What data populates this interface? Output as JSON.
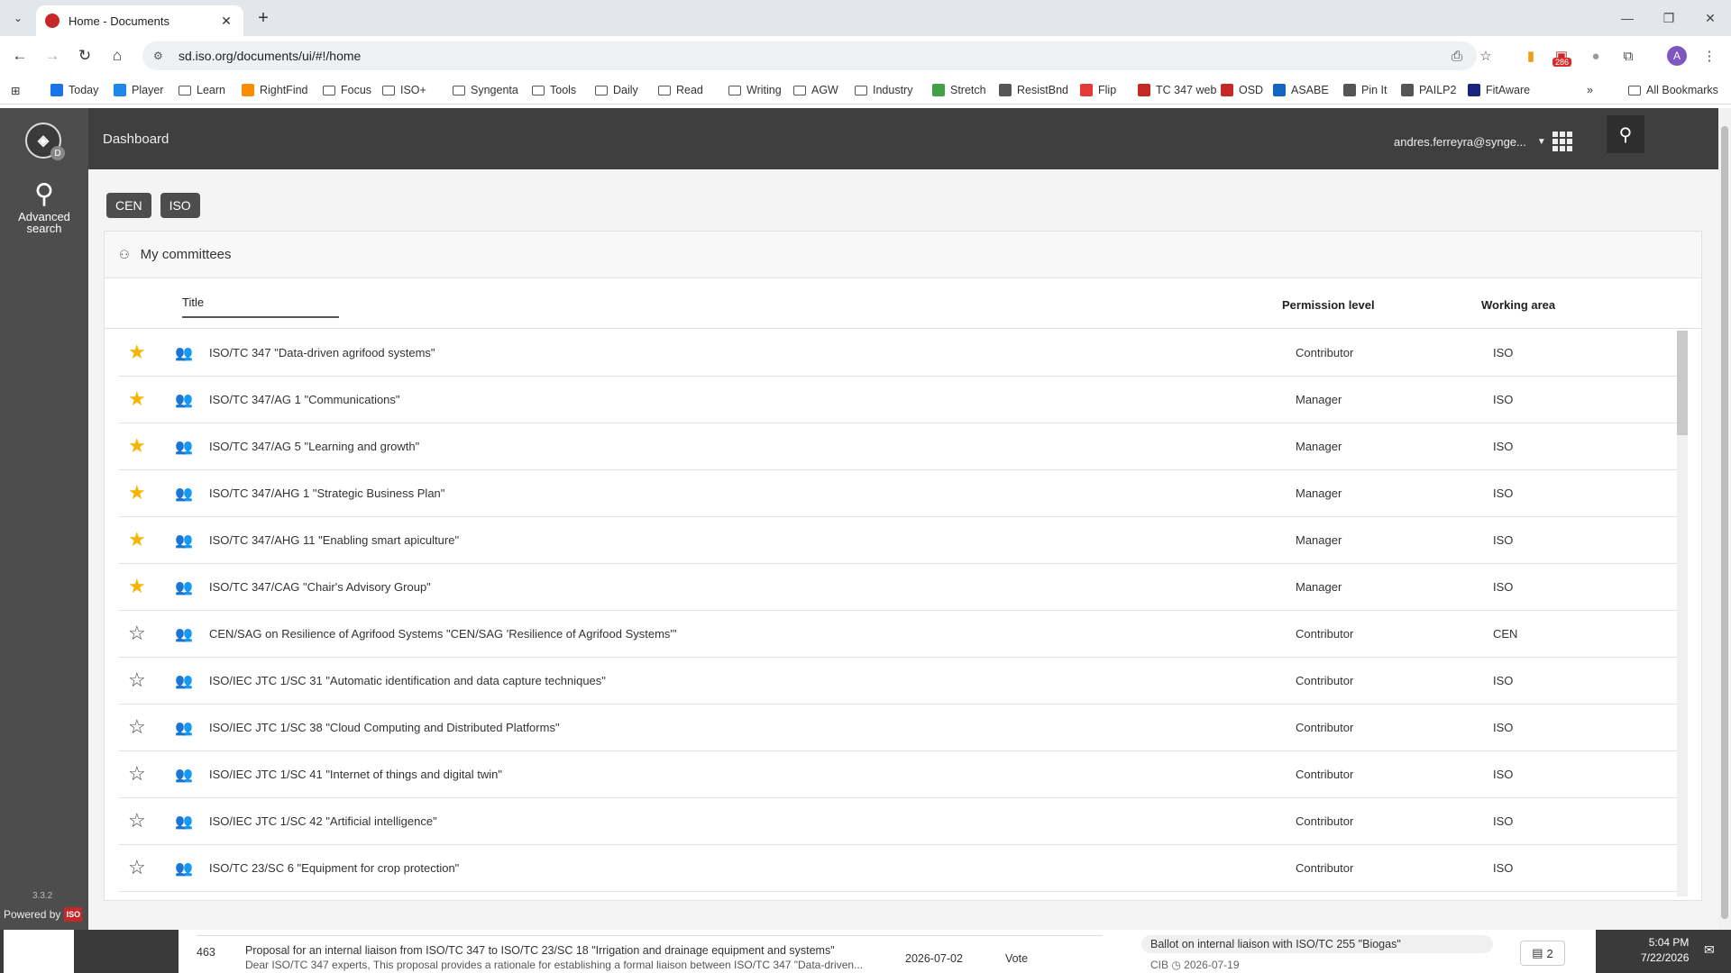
{
  "browser": {
    "tab_title": "Home - Documents",
    "url": "sd.iso.org/documents/ui/#!/home",
    "extension_badge": "286",
    "profile_initial": "A",
    "bookmarks": [
      {
        "label": "Today",
        "kind": "icon",
        "color": "#1a73e8"
      },
      {
        "label": "Player",
        "kind": "icon",
        "color": "#1e88e5"
      },
      {
        "label": "Learn",
        "kind": "folder"
      },
      {
        "label": "RightFind",
        "kind": "icon",
        "color": "#fb8c00"
      },
      {
        "label": "Focus",
        "kind": "folder"
      },
      {
        "label": "ISO+",
        "kind": "folder"
      },
      {
        "label": "Syngenta",
        "kind": "folder"
      },
      {
        "label": "Tools",
        "kind": "folder"
      },
      {
        "label": "Daily",
        "kind": "folder"
      },
      {
        "label": "Read",
        "kind": "folder"
      },
      {
        "label": "Writing",
        "kind": "folder"
      },
      {
        "label": "AGW",
        "kind": "folder"
      },
      {
        "label": "Industry",
        "kind": "folder"
      },
      {
        "label": "Stretch",
        "kind": "icon",
        "color": "#43a047"
      },
      {
        "label": "ResistBnd",
        "kind": "icon",
        "color": "#555555"
      },
      {
        "label": "Flip",
        "kind": "icon",
        "color": "#e53935"
      },
      {
        "label": "TC 347 web",
        "kind": "icon",
        "color": "#c62828"
      },
      {
        "label": "OSD",
        "kind": "icon",
        "color": "#c62828"
      },
      {
        "label": "ASABE",
        "kind": "icon",
        "color": "#1565c0"
      },
      {
        "label": "Pin It",
        "kind": "icon",
        "color": "#555555"
      },
      {
        "label": "PAILP2",
        "kind": "icon",
        "color": "#555555"
      },
      {
        "label": "FitAware",
        "kind": "icon",
        "color": "#1a237e"
      }
    ],
    "all_bookmarks": "All Bookmarks"
  },
  "sidebar": {
    "advanced_search": "Advanced search",
    "logo_badge": "D",
    "version": "3.3.2",
    "powered_by": "Powered by",
    "powered_logo": "ISO"
  },
  "topbar": {
    "title": "Dashboard",
    "user": "andres.ferreyra@synge..."
  },
  "filters": [
    "CEN",
    "ISO"
  ],
  "committees": {
    "header": "My committees",
    "columns": {
      "title": "Title",
      "permission": "Permission level",
      "area": "Working area"
    },
    "rows": [
      {
        "starred": true,
        "title": "ISO/TC 347 \"Data-driven agrifood systems\"",
        "permission": "Contributor",
        "area": "ISO"
      },
      {
        "starred": true,
        "title": "ISO/TC 347/AG 1 \"Communications\"",
        "permission": "Manager",
        "area": "ISO"
      },
      {
        "starred": true,
        "title": "ISO/TC 347/AG 5 \"Learning and growth\"",
        "permission": "Manager",
        "area": "ISO"
      },
      {
        "starred": true,
        "title": "ISO/TC 347/AHG 1 \"Strategic Business Plan\"",
        "permission": "Manager",
        "area": "ISO"
      },
      {
        "starred": true,
        "title": "ISO/TC 347/AHG 11 \"Enabling smart apiculture\"",
        "permission": "Manager",
        "area": "ISO"
      },
      {
        "starred": true,
        "title": "ISO/TC 347/CAG \"Chair's Advisory Group\"",
        "permission": "Manager",
        "area": "ISO"
      },
      {
        "starred": false,
        "title": "CEN/SAG on Resilience of Agrifood Systems \"CEN/SAG 'Resilience of Agrifood Systems'\"",
        "permission": "Contributor",
        "area": "CEN"
      },
      {
        "starred": false,
        "title": "ISO/IEC JTC 1/SC 31 \"Automatic identification and data capture techniques\"",
        "permission": "Contributor",
        "area": "ISO"
      },
      {
        "starred": false,
        "title": "ISO/IEC JTC 1/SC 38 \"Cloud Computing and Distributed Platforms\"",
        "permission": "Contributor",
        "area": "ISO"
      },
      {
        "starred": false,
        "title": "ISO/IEC JTC 1/SC 41 \"Internet of things and digital twin\"",
        "permission": "Contributor",
        "area": "ISO"
      },
      {
        "starred": false,
        "title": "ISO/IEC JTC 1/SC 42 \"Artificial intelligence\"",
        "permission": "Contributor",
        "area": "ISO"
      },
      {
        "starred": false,
        "title": "ISO/TC 23/SC 6 \"Equipment for crop protection\"",
        "permission": "Contributor",
        "area": "ISO"
      }
    ]
  },
  "background": {
    "item_number": "463",
    "item_title": "Proposal for an internal liaison from ISO/TC 347 to ISO/TC 23/SC 18 \"Irrigation and drainage equipment and systems\"",
    "item_excerpt": "Dear ISO/TC 347 experts, This proposal provides a rationale for establishing a formal liaison between ISO/TC 347 \"Data-driven...",
    "item_date": "2026-07-02",
    "item_type": "Vote",
    "ballot_title": "Ballot on internal liaison with ISO/TC 255 \"Biogas\"",
    "ballot_meta": "CIB  ◷ 2026-07-19",
    "ballot_docs": "2",
    "clock_time": "5:04 PM",
    "clock_date": "7/22/2026"
  }
}
